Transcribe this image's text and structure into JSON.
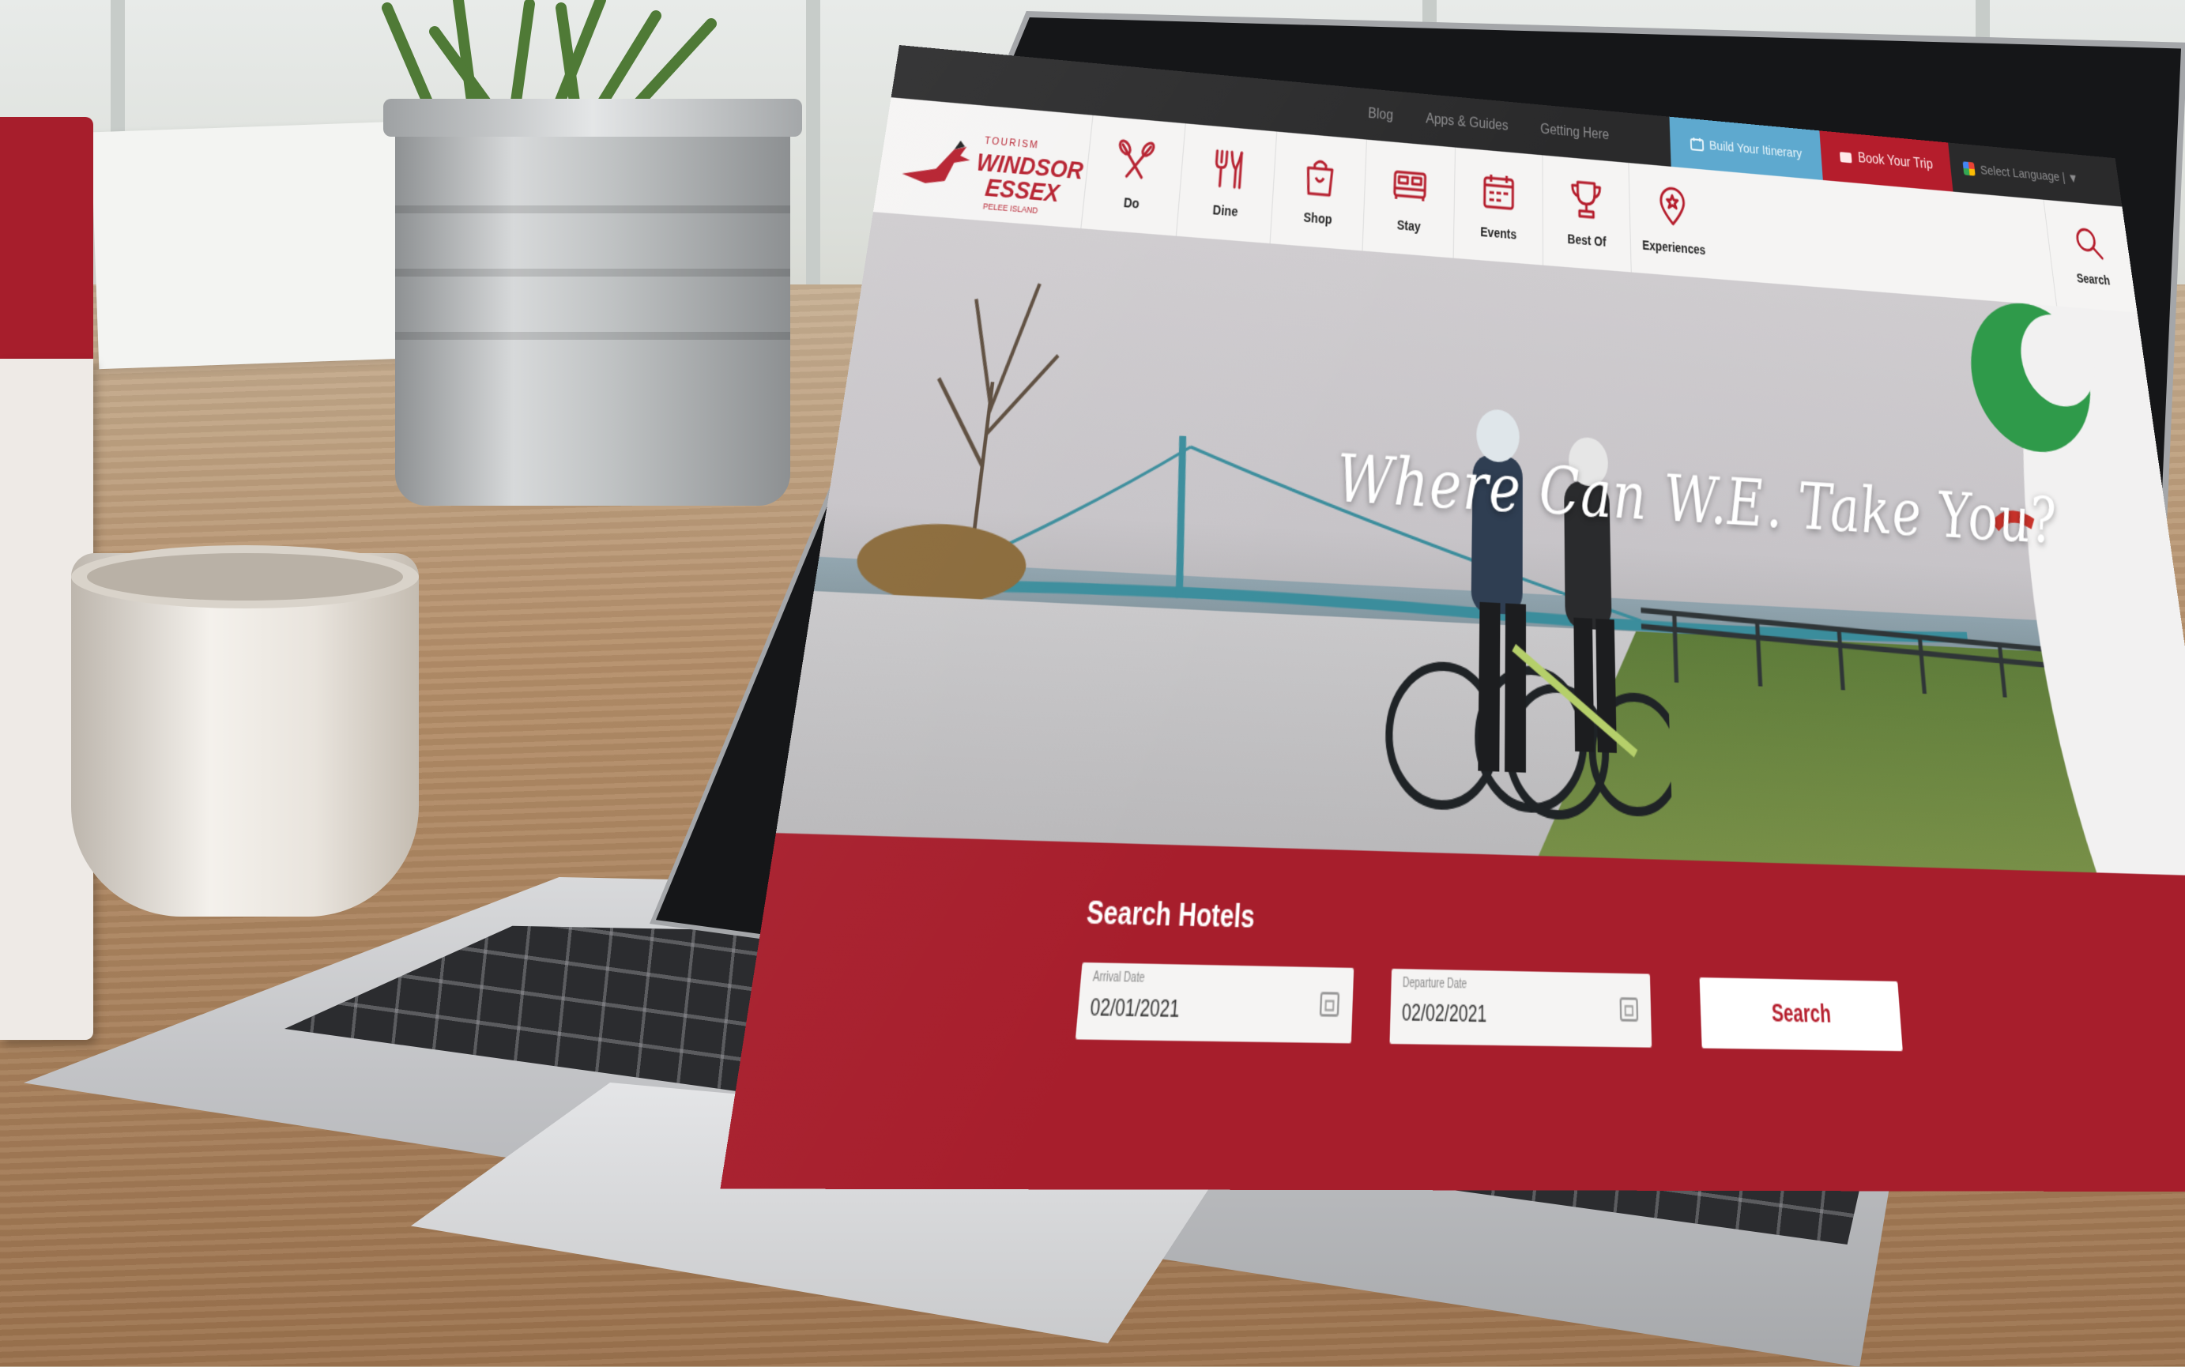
{
  "topbar": {
    "links": [
      "Blog",
      "Apps & Guides",
      "Getting Here"
    ],
    "itinerary_label": "Build Your Itinerary",
    "book_label": "Book Your Trip",
    "language_label": "Select Language | ▼"
  },
  "logo": {
    "small": "TOURISM",
    "line1": "WINDSOR",
    "line2": "ESSEX",
    "tag": "PELEE ISLAND"
  },
  "nav": {
    "items": [
      {
        "label": "Do",
        "icon": "paddles-icon"
      },
      {
        "label": "Dine",
        "icon": "dining-icon"
      },
      {
        "label": "Shop",
        "icon": "shopping-bag-icon"
      },
      {
        "label": "Stay",
        "icon": "bed-icon"
      },
      {
        "label": "Events",
        "icon": "calendar-icon"
      },
      {
        "label": "Best Of",
        "icon": "trophy-icon"
      },
      {
        "label": "Experiences",
        "icon": "location-pin-icon"
      }
    ],
    "search_label": "Search"
  },
  "hero": {
    "headline": "Where Can W.E. Take You?"
  },
  "search_hotels": {
    "title": "Search Hotels",
    "arrival_label": "Arrival Date",
    "arrival_value": "02/01/2021",
    "departure_label": "Departure Date",
    "departure_value": "02/02/2021",
    "button_label": "Search"
  },
  "colors": {
    "brand_red": "#b51d2c",
    "itinerary_blue": "#5ea9cf",
    "topbar_dark": "#2a2a2b"
  }
}
